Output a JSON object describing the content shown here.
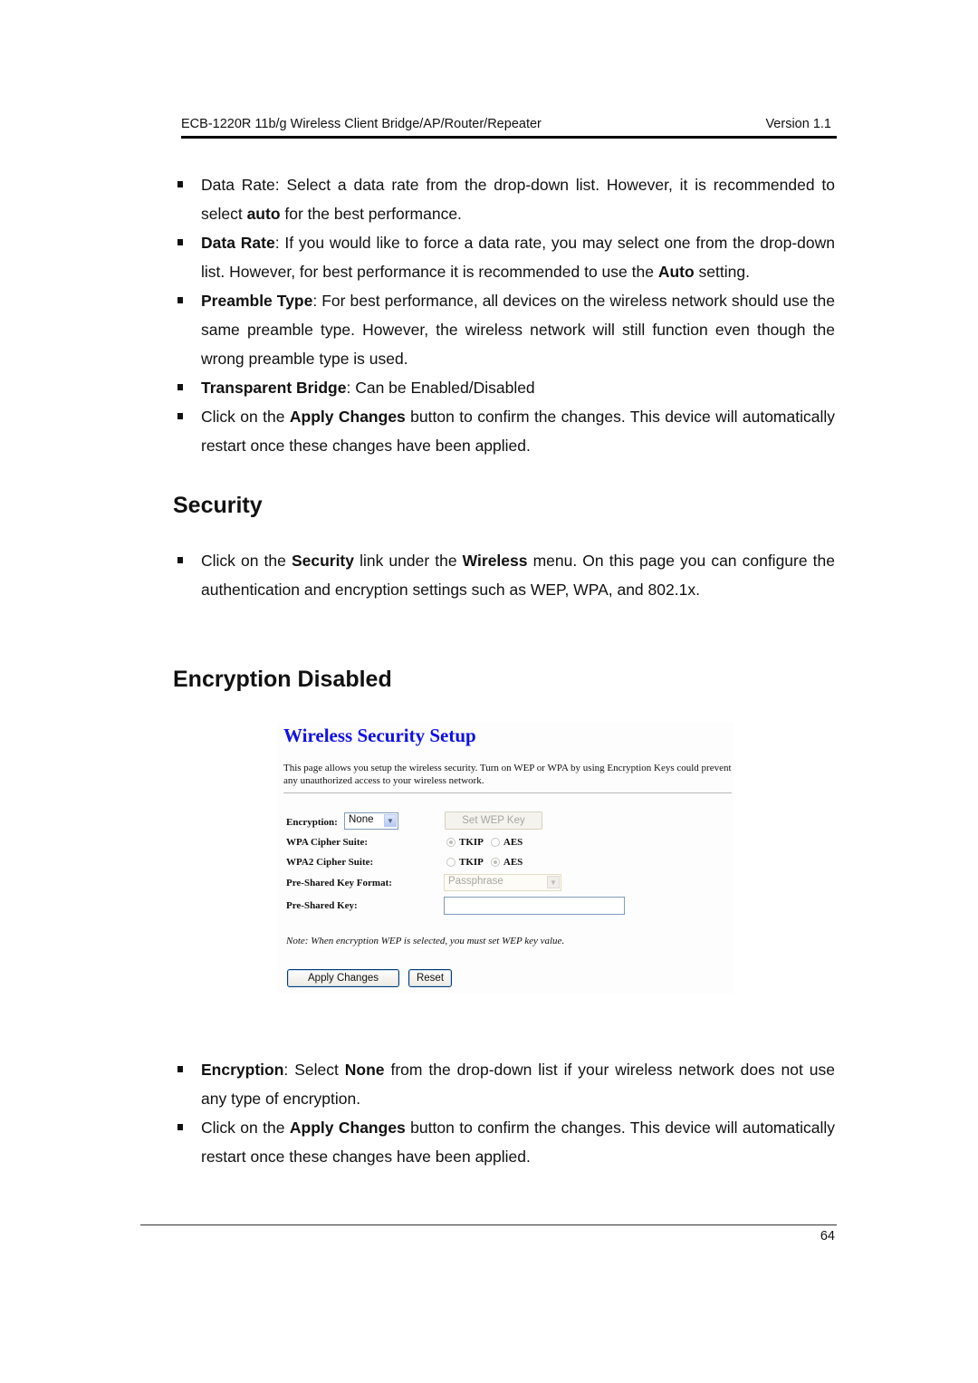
{
  "header": {
    "title": "ECB-1220R 11b/g Wireless Client Bridge/AP/Router/Repeater",
    "version": "Version 1.1"
  },
  "top_bullets": [
    {
      "pre": "Data Rate: Select a data rate from the drop-down list. However, it is recommended to select ",
      "bold1": "auto",
      "post": " for the best performance."
    },
    {
      "bold0": "Data Rate",
      "pre": ": If you would like to force a data rate, you may select one from the drop-down list. However, for best performance it is recommended to use the ",
      "bold1": "Auto",
      "post": " setting."
    },
    {
      "bold0": "Preamble Type",
      "pre": ": For best performance, all devices on the wireless network should use the same preamble type. However, the wireless network will still function even though the wrong preamble type is used."
    },
    {
      "bold0": "Transparent Bridge",
      "pre": ": Can be Enabled/Disabled"
    },
    {
      "pre": "Click on the ",
      "bold1": "Apply Changes",
      "post": " button to confirm the changes. This device will automatically restart once these changes have been applied."
    }
  ],
  "security_heading": "Security",
  "security_bullet": {
    "pre": "Click on the ",
    "bold1": "Security",
    "mid": " link under the ",
    "bold2": "Wireless",
    "post": " menu. On this page you can configure the authentication and encryption settings such as WEP, WPA, and 802.1x."
  },
  "encryption_heading": "Encryption Disabled",
  "screenshot": {
    "title": "Wireless Security Setup",
    "description": "This page allows you setup the wireless security. Turn on WEP or WPA by using Encryption Keys could prevent any unauthorized access to your wireless network.",
    "encryption_label": "Encryption:",
    "encryption_value": "None",
    "set_wep_key_label": "Set WEP Key",
    "wpa_cipher_label": "WPA Cipher Suite:",
    "wpa2_cipher_label": "WPA2 Cipher Suite:",
    "tkip_label": "TKIP",
    "aes_label": "AES",
    "psk_format_label": "Pre-Shared Key Format:",
    "psk_format_value": "Passphrase",
    "psk_label": "Pre-Shared Key:",
    "psk_value": "",
    "note": "Note: When encryption WEP is selected, you must set WEP key value.",
    "apply_label": "Apply Changes",
    "reset_label": "Reset",
    "wpa_selected": "TKIP",
    "wpa2_selected": "AES"
  },
  "bottom_bullets": [
    {
      "bold0": "Encryption",
      "pre": ": Select ",
      "bold1": "None",
      "post": " from the drop-down list if your wireless network does not use any type of encryption."
    },
    {
      "pre": "Click on the ",
      "bold1": "Apply Changes",
      "post": " button to confirm the changes. This device will automatically restart once these changes have been applied."
    }
  ],
  "footer": {
    "page_number": "64"
  }
}
